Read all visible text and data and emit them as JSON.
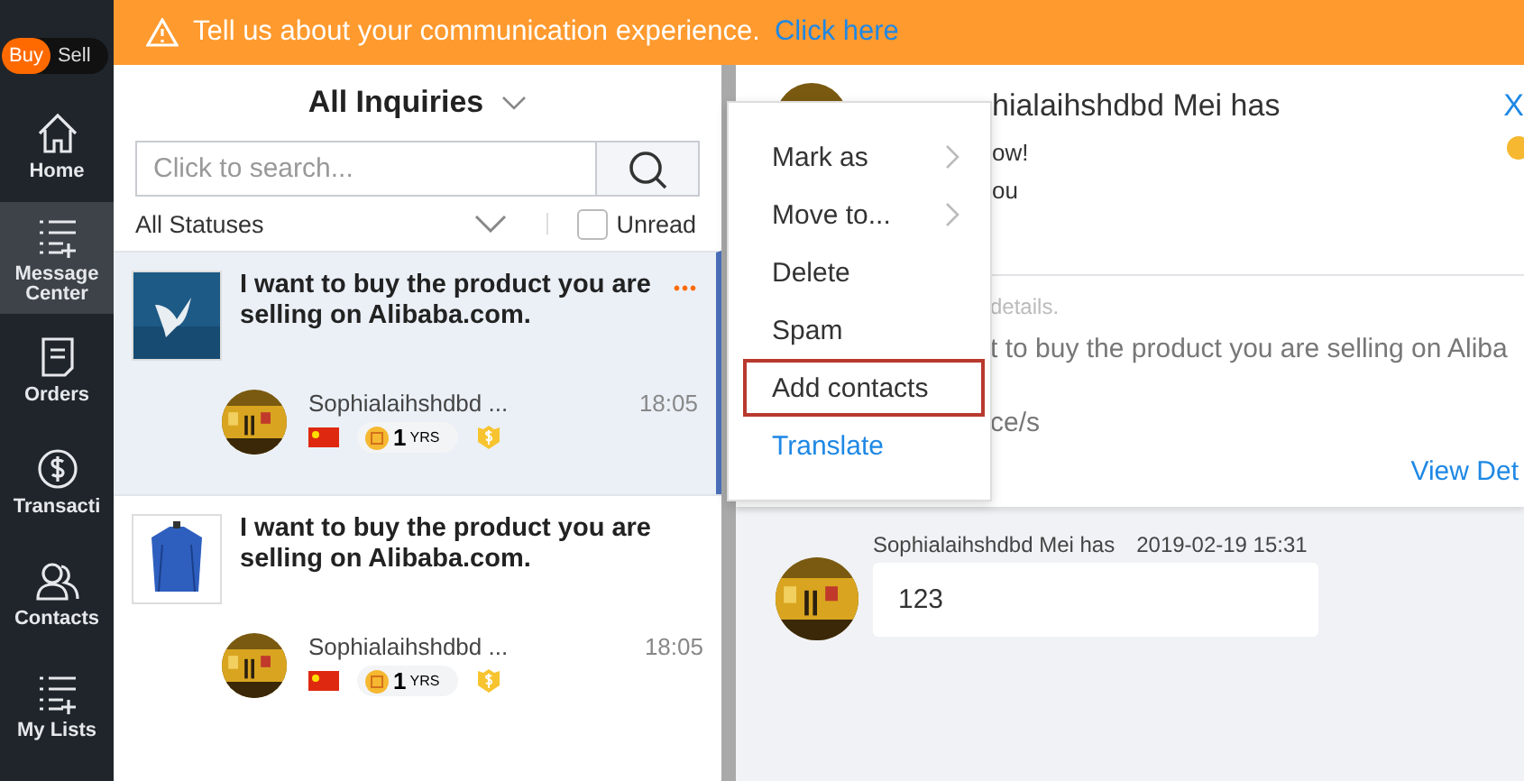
{
  "sidebar": {
    "mode_toggle": [
      {
        "label": "Buy",
        "selected": true
      },
      {
        "label": "Sell",
        "selected": false
      }
    ],
    "items": [
      {
        "label": "Home",
        "selected": false
      },
      {
        "label": "Message Center",
        "selected": true
      },
      {
        "label": "Orders",
        "selected": false
      },
      {
        "label": "Transacti",
        "selected": false
      },
      {
        "label": "Contacts",
        "selected": false
      },
      {
        "label": "My Lists",
        "selected": false
      }
    ]
  },
  "banner": {
    "text": "Tell us about your communication experience.",
    "link": "Click here"
  },
  "inquiries": {
    "title": "All Inquiries",
    "search": {
      "placeholder": "Click to search..."
    },
    "status_filter": "All Statuses",
    "unread": {
      "label": "Unread",
      "checked": false
    },
    "rows": [
      {
        "subject": "I want to buy the product you are selling on Alibaba.com.",
        "sender": "Sophialaihshdbd ...",
        "time": "18:05",
        "years": "1",
        "years_unit": "YRS",
        "selected": true,
        "more": "•••"
      },
      {
        "subject": "I want to buy the product you are selling on Alibaba.com.",
        "sender": "Sophialaihshdbd ...",
        "time": "18:05",
        "years": "1",
        "years_unit": "YRS",
        "selected": false
      }
    ]
  },
  "context_menu": [
    {
      "label": "Mark as",
      "kind": "submenu",
      "outlined": false
    },
    {
      "label": "Move to...",
      "kind": "submenu",
      "outlined": false
    },
    {
      "label": "Delete",
      "kind": "action",
      "outlined": false
    },
    {
      "label": "Spam",
      "kind": "action",
      "outlined": false
    },
    {
      "label": "Add contacts",
      "kind": "action",
      "outlined": true
    },
    {
      "label": "Translate",
      "kind": "link",
      "outlined": false
    }
  ],
  "detail": {
    "header_name": "hialaihshdbd Mei has",
    "close": "X",
    "line_1": "ow!",
    "line_2": "ou",
    "hint": "details.",
    "body": "t to buy the product you are selling on Aliba",
    "quantity": "ce/s",
    "view_link": "View Det",
    "message": {
      "sender": "Sophialaihshdbd Mei has",
      "time": "2019-02-19 15:31",
      "text": "123"
    }
  }
}
